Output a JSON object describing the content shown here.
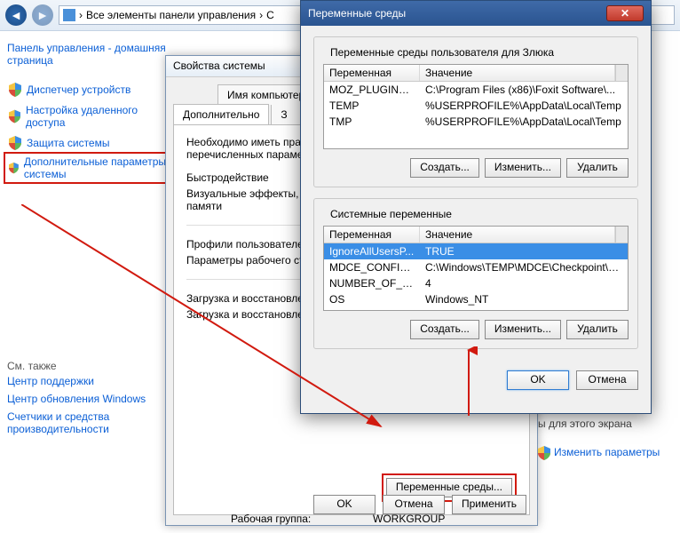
{
  "nav": {
    "breadcrumb_icon": "control-panel-icon",
    "breadcrumb1": "Все элементы панели управления",
    "breadcrumb_sep": "›",
    "breadcrumb2": "С"
  },
  "sidebar": {
    "home": "Панель управления - домашняя страница",
    "items": [
      "Диспетчер устройств",
      "Настройка удаленного доступа",
      "Защита системы",
      "Дополнительные параметры системы"
    ],
    "see_also_title": "См. также",
    "see_also": [
      "Центр поддержки",
      "Центр обновления Windows",
      "Счетчики и средства производительности"
    ]
  },
  "sysprops": {
    "title": "Свойства системы",
    "tab_computer_name": "Имя компьютера",
    "tab_additional": "Дополнительно",
    "tab_hidden": "З",
    "intro": "Необходимо иметь права администратора для изменения перечисленных параметров",
    "perf_title": "Быстродействие",
    "perf_desc": "Визуальные эффекты, использование процессора, виртуальной памяти",
    "profiles_title": "Профили пользователей",
    "profiles_desc": "Параметры рабочего стола",
    "startup_title": "Загрузка и восстановление",
    "startup_desc": "Загрузка и восстановление",
    "env_btn": "Переменные среды...",
    "ok": "OK",
    "cancel": "Отмена",
    "apply": "Применить"
  },
  "env": {
    "title": "Переменные среды",
    "user_legend": "Переменные среды пользователя для Злюка",
    "sys_legend": "Системные переменные",
    "col_var": "Переменная",
    "col_val": "Значение",
    "user_vars": [
      {
        "name": "MOZ_PLUGIN_P...",
        "value": "C:\\Program Files (x86)\\Foxit Software\\..."
      },
      {
        "name": "TEMP",
        "value": "%USERPROFILE%\\AppData\\Local\\Temp"
      },
      {
        "name": "TMP",
        "value": "%USERPROFILE%\\AppData\\Local\\Temp"
      }
    ],
    "sys_vars": [
      {
        "name": "IgnoreAllUsersP...",
        "value": "TRUE"
      },
      {
        "name": "MDCE_CONFIG_...",
        "value": "C:\\Windows\\TEMP\\MDCE\\Checkpoint\\w..."
      },
      {
        "name": "NUMBER_OF_P...",
        "value": "4"
      },
      {
        "name": "OS",
        "value": "Windows_NT"
      }
    ],
    "sys_selected": 0,
    "create": "Создать...",
    "edit": "Изменить...",
    "delete": "Удалить",
    "ok": "OK",
    "cancel": "Отмена"
  },
  "right": {
    "already": "ы для этого экрана",
    "change": "Изменить параметры"
  },
  "footer": {
    "label": "Рабочая группа:",
    "value": "WORKGROUP"
  }
}
